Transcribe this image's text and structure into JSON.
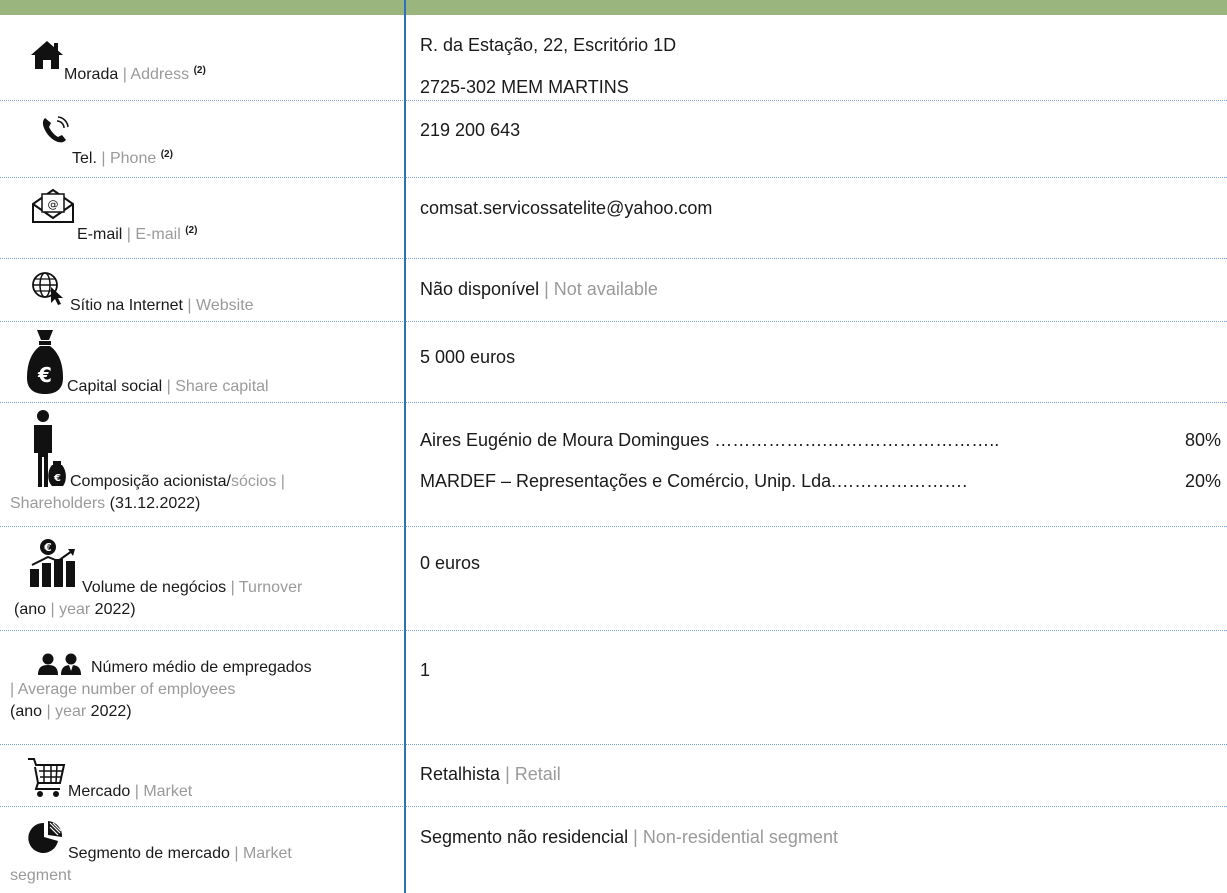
{
  "sup_mark": "(2)",
  "separator": "|",
  "address": {
    "label_pt": "Morada",
    "label_en": "Address",
    "line1": "R. da Estação, 22, Escritório 1D",
    "line2": "2725-302 MEM MARTINS",
    "icon": "house-icon"
  },
  "phone": {
    "label_pt": "Tel.",
    "label_en": "Phone",
    "value": "219 200 643",
    "icon": "phone-icon"
  },
  "email": {
    "label_pt": "E-mail",
    "label_en": "E-mail",
    "value": "comsat.servicossatelite@yahoo.com",
    "icon": "envelope-icon"
  },
  "website": {
    "label_pt": "Sítio na Internet",
    "label_en": "Website",
    "value_pt": "Não disponível",
    "value_en": "Not available",
    "icon": "globe-cursor-icon"
  },
  "capital": {
    "label_pt": "Capital social",
    "label_en": "Share capital",
    "value": "5 000 euros",
    "icon": "money-bag-euro-icon"
  },
  "shareholders": {
    "label_pt": "Composição acionista/",
    "label_pt2": "sócios",
    "label_en": "Shareholders",
    "date": "(31.12.2022)",
    "items": [
      {
        "name": "Aires Eugénio de Moura Domingues",
        "dots": "……………….……………………….. ",
        "pct": "80%"
      },
      {
        "name": "MARDEF – Representações e Comércio, Unip. Lda.",
        "dots": "…………………. ",
        "pct": "20%"
      }
    ],
    "icon": "person-money-bag-icon"
  },
  "turnover": {
    "label_pt": "Volume de negócios",
    "label_en": "Turnover",
    "year_pt": "(ano",
    "year_en": "year",
    "year": "2022)",
    "value": "0 euros",
    "icon": "bar-chart-euro-icon"
  },
  "employees": {
    "label_pt": "Número médio de empregados",
    "label_en": "| Average number of employees",
    "year_pt": "(ano",
    "year_en": "year",
    "year": "2022)",
    "value": "1",
    "icon": "two-people-icon"
  },
  "market": {
    "label_pt": "Mercado",
    "label_en": "Market",
    "value_pt": "Retalhista",
    "value_en": "Retail",
    "icon": "shopping-cart-icon"
  },
  "segment": {
    "label_pt": "Segmento de mercado",
    "label_en": "Market",
    "label_en2": "segment",
    "value_pt": "Segmento não residencial",
    "value_en": "Non-residential segment",
    "icon": "pie-chart-icon"
  },
  "colors": {
    "top_bar": "#9bb57f",
    "divider": "#2f72b8",
    "english_text": "#9a9a9a"
  }
}
